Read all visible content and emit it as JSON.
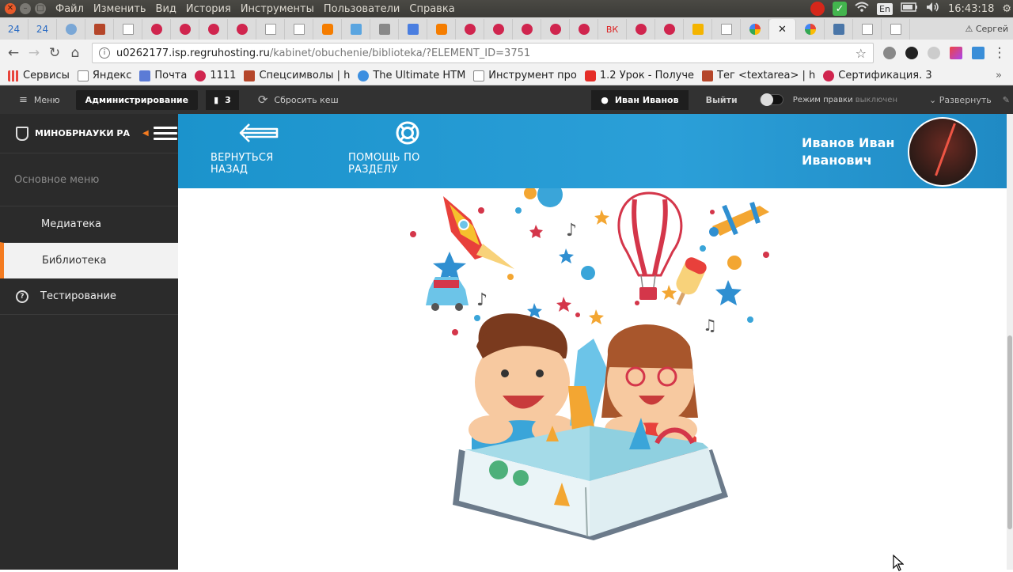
{
  "os": {
    "menu": [
      "Файл",
      "Изменить",
      "Вид",
      "История",
      "Инструменты",
      "Пользователи",
      "Справка"
    ],
    "lang": "En",
    "time": "16:43:18"
  },
  "tabs": {
    "counts": [
      "24",
      "24"
    ],
    "profile": "Сергей",
    "vk_label": "ВК"
  },
  "address": {
    "host": "u0262177.isp.regruhosting.ru",
    "path": "/kabinet/obuchenie/biblioteka/?ELEMENT_ID=3751"
  },
  "bookmarks": [
    {
      "label": "Сервисы",
      "color": "#e8453c"
    },
    {
      "label": "Яндекс",
      "color": "#ffffff"
    },
    {
      "label": "Почта",
      "color": "#5b7bd6"
    },
    {
      "label": "1111",
      "color": "#d0254e"
    },
    {
      "label": "Спецсимволы | h",
      "color": "#b5462a"
    },
    {
      "label": "The Ultimate HTM",
      "color": "#3c8fe0"
    },
    {
      "label": "Инструмент про",
      "color": "#ffffff"
    },
    {
      "label": "1.2 Урок - Получе",
      "color": "#e52d27"
    },
    {
      "label": "Тег <textarea> | h",
      "color": "#b5462a"
    },
    {
      "label": "Сертификация. 3",
      "color": "#d0254e"
    }
  ],
  "admin": {
    "menu": "Меню",
    "administration": "Администрирование",
    "badge": "3",
    "reset_cache": "Сбросить кеш",
    "user": "Иван Иванов",
    "logout": "Выйти",
    "edit_mode": "Режим правки",
    "edit_mode_state": "выключен",
    "expand": "Развернуть"
  },
  "sidebar": {
    "logo": "МИНОБРНАУКИ РА",
    "section": "Основное меню",
    "items": [
      {
        "label": "Медиатека"
      },
      {
        "label": "Библиотека"
      }
    ],
    "testing": "Тестирование"
  },
  "header": {
    "back": "ВЕРНУТЬСЯ НАЗАД",
    "help": "ПОМОЩЬ ПО РАЗДЕЛУ",
    "user_name": "Иванов Иван Иванович"
  },
  "colors": {
    "accent": "#f47b20",
    "header_blue": "#2b9fd8",
    "sidebar": "#2b2b2b"
  }
}
